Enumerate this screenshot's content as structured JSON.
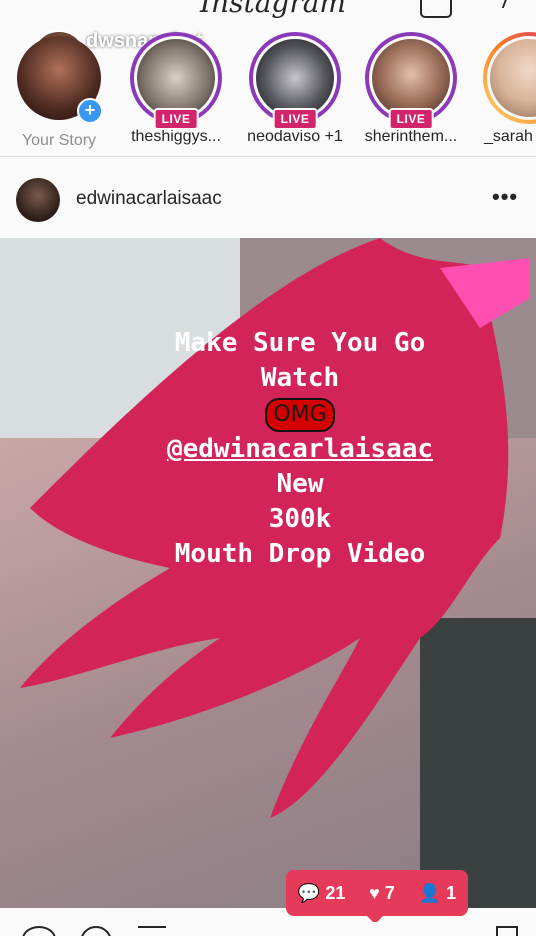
{
  "app": {
    "logo": "Instagram"
  },
  "stories": [
    {
      "username": "Your Story",
      "overlay_name": "dwsnapshot"
    },
    {
      "username": "theshiggys...",
      "badge": "LIVE"
    },
    {
      "username": "neodaviso +1",
      "badge": "LIVE"
    },
    {
      "username": "sherinthem...",
      "badge": "LIVE"
    },
    {
      "username": "_sarah"
    }
  ],
  "post": {
    "username": "edwinacarlaisaac",
    "more_label": "•••",
    "promo": {
      "line1": "Make Sure You Go",
      "line2": "Watch",
      "omg": "OMG",
      "handle": "@edwinacarlaisaac",
      "line5": "New",
      "line6": "300k",
      "line7": "Mouth Drop Video"
    },
    "counters": {
      "comments": "21",
      "likes": "7",
      "followers": "1"
    }
  },
  "colors": {
    "live_badge": "#d1246b",
    "scribble": "#d3245a",
    "counter_pill": "#e53a5a",
    "story_ring": "#8a3ab9"
  }
}
